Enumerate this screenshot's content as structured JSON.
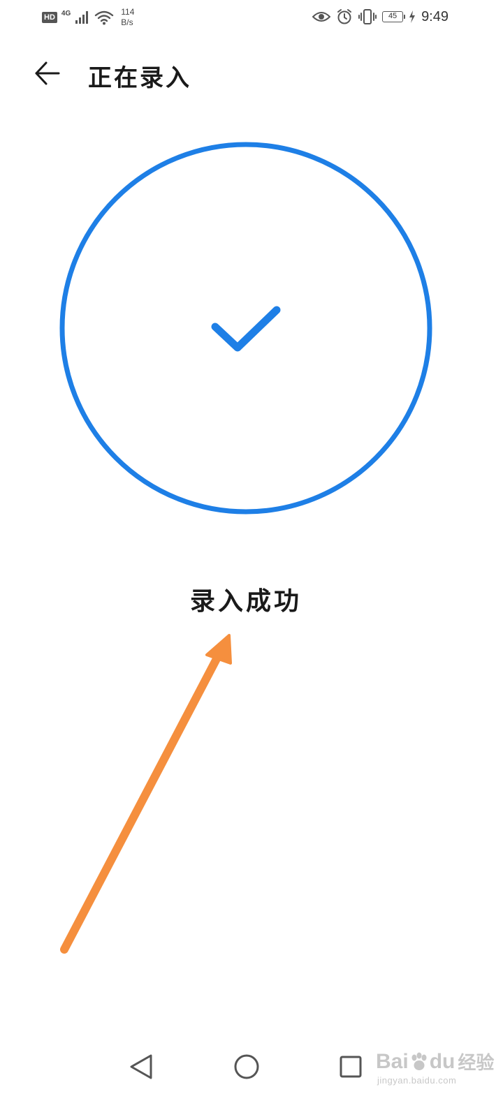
{
  "status_bar": {
    "hd_label": "HD",
    "network_type": "4G",
    "speed_value": "114",
    "speed_unit": "B/s",
    "battery_level": "45",
    "time": "9:49",
    "icons": [
      "signal-icon",
      "wifi-icon",
      "eye-icon",
      "alarm-icon",
      "vibrate-icon",
      "battery-icon",
      "charging-icon"
    ]
  },
  "header": {
    "title": "正在录入",
    "back_icon": "arrow-left-icon"
  },
  "main": {
    "status_message": "录入成功",
    "success_icon": "checkmark-icon"
  },
  "nav_bar": {
    "icons": [
      "nav-back-icon",
      "nav-home-icon",
      "nav-recents-icon"
    ]
  },
  "watermark": {
    "brand_left": "Bai",
    "brand_right": "du",
    "brand_suffix": "经验",
    "url": "jingyan.baidu.com"
  },
  "colors": {
    "accent": "#1E7FE6",
    "annotation": "#F58F3E",
    "text": "#1a1a1a",
    "background": "#ffffff"
  }
}
